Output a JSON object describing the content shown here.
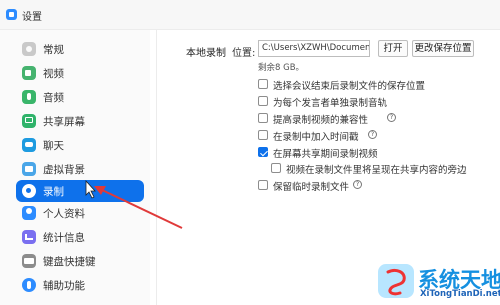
{
  "window": {
    "title": "设置"
  },
  "sidebar": {
    "items": [
      {
        "label": "常规",
        "icon": "general-icon"
      },
      {
        "label": "视频",
        "icon": "video-icon"
      },
      {
        "label": "音频",
        "icon": "audio-icon"
      },
      {
        "label": "共享屏幕",
        "icon": "share-screen-icon"
      },
      {
        "label": "聊天",
        "icon": "chat-icon"
      },
      {
        "label": "虚拟背景",
        "icon": "virtual-background-icon"
      },
      {
        "label": "录制",
        "icon": "record-icon",
        "active": true
      },
      {
        "label": "个人资料",
        "icon": "profile-icon"
      },
      {
        "label": "统计信息",
        "icon": "statistics-icon"
      },
      {
        "label": "键盘快捷键",
        "icon": "keyboard-icon"
      },
      {
        "label": "辅助功能",
        "icon": "accessibility-icon"
      }
    ]
  },
  "recording": {
    "section_label": "本地录制",
    "location_label": "位置:",
    "path": "C:\\Users\\XZWH\\Documents\\Zoo",
    "open_button": "打开",
    "change_button": "更改保存位置",
    "remaining": "剩余8 GB。",
    "options": [
      {
        "label": "选择会议结束后录制文件的保存位置",
        "checked": false
      },
      {
        "label": "为每个发言者单独录制音轨",
        "checked": false
      },
      {
        "label": "提高录制视频的兼容性",
        "checked": false,
        "help": true
      },
      {
        "label": "在录制中加入时间戳",
        "checked": false,
        "help": true
      },
      {
        "label": "在屏幕共享期间录制视频",
        "checked": true
      },
      {
        "label": "视频在录制文件里将呈现在共享内容的旁边",
        "checked": false,
        "indented": true
      },
      {
        "label": "保留临时录制文件",
        "checked": false,
        "help": true
      }
    ],
    "help_glyph": "?"
  },
  "watermark": {
    "name": "系统天地",
    "url": "XiTongTianDi.net"
  },
  "colors": {
    "accent": "#0e71eb",
    "annotation_arrow": "#e03a3a",
    "watermark": "#1590e0"
  }
}
